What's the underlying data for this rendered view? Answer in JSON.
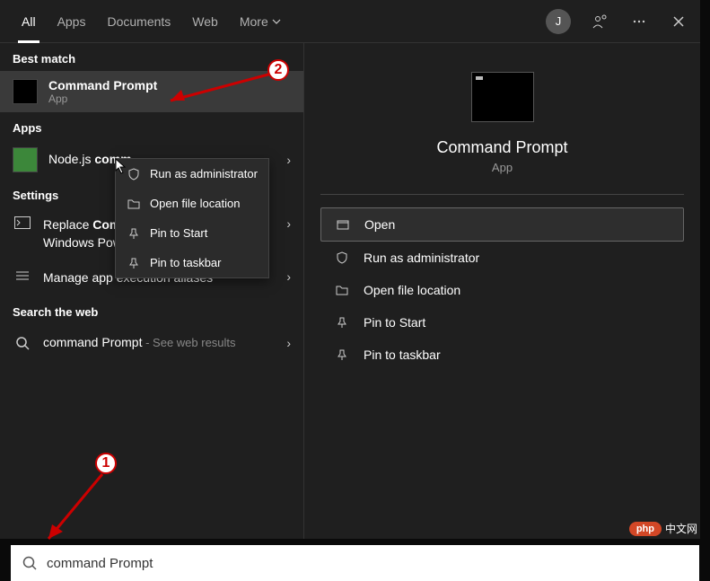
{
  "tabs": {
    "all": "All",
    "apps": "Apps",
    "documents": "Documents",
    "web": "Web",
    "more": "More"
  },
  "avatar": "J",
  "sections": {
    "best_match": "Best match",
    "apps": "Apps",
    "settings": "Settings",
    "web": "Search the web"
  },
  "best_match": {
    "title_bold": "Command Prompt",
    "sub": "App"
  },
  "apps_results": {
    "item0": {
      "prefix": "Node.js ",
      "bold": "comm"
    }
  },
  "settings_results": {
    "item0": {
      "p1": "Replace ",
      "b1": "Command Prompt",
      "p2": " with Windows PowerShell in the Win + X"
    },
    "item1": {
      "text": "Manage app execution aliases"
    }
  },
  "web_results": {
    "item0": {
      "text": "command Prompt",
      "sub": " - See web results"
    }
  },
  "context_menu": {
    "run_admin": "Run as administrator",
    "open_location": "Open file location",
    "pin_start": "Pin to Start",
    "pin_taskbar": "Pin to taskbar"
  },
  "preview": {
    "title": "Command Prompt",
    "sub": "App",
    "actions": {
      "open": "Open",
      "run_admin": "Run as administrator",
      "open_location": "Open file location",
      "pin_start": "Pin to Start",
      "pin_taskbar": "Pin to taskbar"
    }
  },
  "search": {
    "value": "command Prompt"
  },
  "annotations": {
    "n1": "1",
    "n2": "2"
  },
  "watermark": {
    "pill": "php",
    "text": "中文网"
  }
}
